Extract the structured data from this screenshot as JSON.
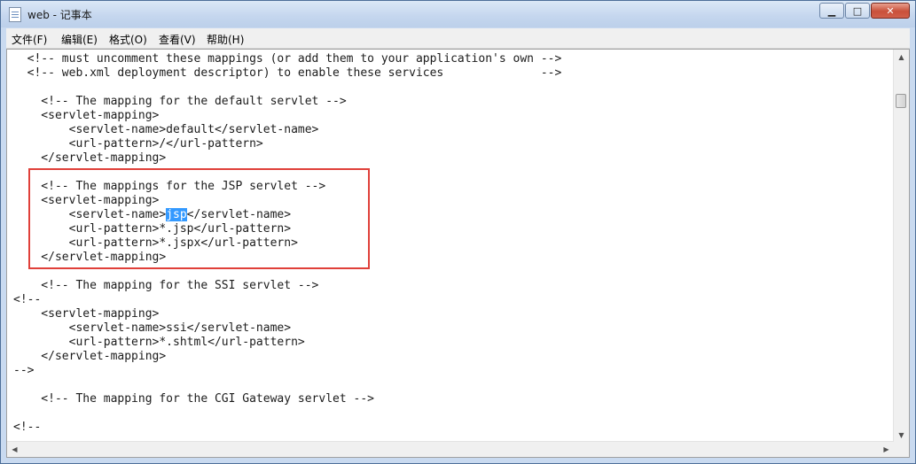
{
  "window": {
    "title": "web - 记事本"
  },
  "window_buttons": {
    "minimize": "▁",
    "maximize": "□",
    "close": "✕"
  },
  "menu": {
    "items": [
      {
        "label": "文件(F)"
      },
      {
        "label": "编辑(E)"
      },
      {
        "label": "格式(O)"
      },
      {
        "label": "查看(V)"
      },
      {
        "label": "帮助(H)"
      }
    ]
  },
  "editor": {
    "selected_text": "jsp",
    "lines_before": [
      "  <!-- must uncomment these mappings (or add them to your application's own -->",
      "  <!-- web.xml deployment descriptor) to enable these services              -->",
      "",
      "    <!-- The mapping for the default servlet -->",
      "    <servlet-mapping>",
      "        <servlet-name>default</servlet-name>",
      "        <url-pattern>/</url-pattern>",
      "    </servlet-mapping>",
      "",
      "    <!-- The mappings for the JSP servlet -->",
      "    <servlet-mapping>"
    ],
    "selected_line_prefix": "        <servlet-name>",
    "selected_line_suffix": "</servlet-name>",
    "lines_after": [
      "        <url-pattern>*.jsp</url-pattern>",
      "        <url-pattern>*.jspx</url-pattern>",
      "    </servlet-mapping>",
      "",
      "    <!-- The mapping for the SSI servlet -->",
      "<!--",
      "    <servlet-mapping>",
      "        <servlet-name>ssi</servlet-name>",
      "        <url-pattern>*.shtml</url-pattern>",
      "    </servlet-mapping>",
      "-->",
      "",
      "    <!-- The mapping for the CGI Gateway servlet -->",
      "",
      "<!--"
    ]
  },
  "scrollbar": {
    "up": "▲",
    "down": "▼",
    "left": "◀",
    "right": "▶"
  }
}
